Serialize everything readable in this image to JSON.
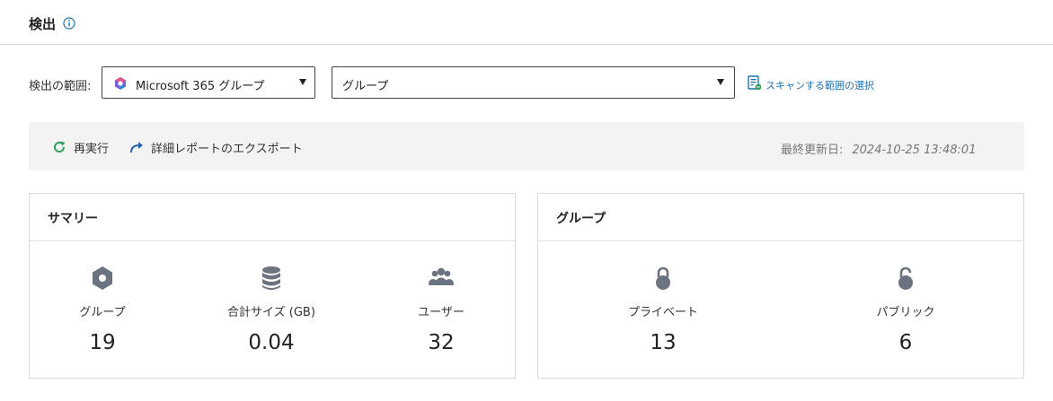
{
  "header": {
    "title": "検出"
  },
  "scope": {
    "label": "検出の範囲:",
    "select1_value": "Microsoft 365 グループ",
    "select2_value": "グループ",
    "scan_link": "スキャンする範囲の選択"
  },
  "toolbar": {
    "rerun_label": "再実行",
    "export_label": "詳細レポートのエクスポート",
    "last_updated_label": "最終更新日:",
    "last_updated_value": "2024-10-25 13:48:01"
  },
  "summary": {
    "title": "サマリー",
    "metrics": [
      {
        "icon": "hexagon-icon",
        "label": "グループ",
        "value": "19"
      },
      {
        "icon": "database-icon",
        "label": "合計サイズ (GB)",
        "value": "0.04"
      },
      {
        "icon": "users-icon",
        "label": "ユーザー",
        "value": "32"
      }
    ]
  },
  "groups": {
    "title": "グループ",
    "metrics": [
      {
        "icon": "lock-closed-icon",
        "label": "プライベート",
        "value": "13"
      },
      {
        "icon": "lock-open-icon",
        "label": "パブリック",
        "value": "6"
      }
    ]
  },
  "colors": {
    "link": "#1a73b8",
    "icon_gray": "#6b7280",
    "rerun_green": "#2e9e58",
    "export_blue": "#2a62b0"
  }
}
